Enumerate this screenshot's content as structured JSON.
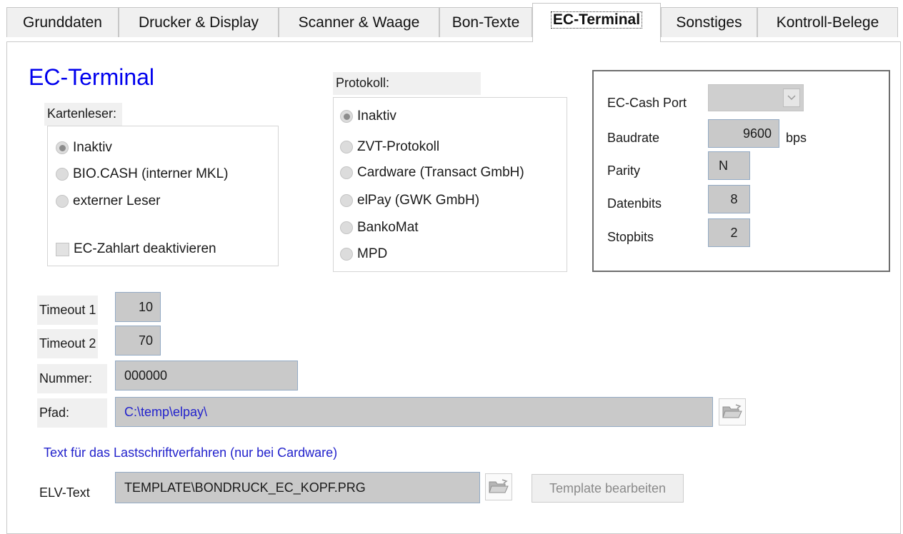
{
  "tabs": [
    "Grunddaten",
    "Drucker & Display",
    "Scanner & Waage",
    "Bon-Texte",
    "EC-Terminal",
    "Sonstiges",
    "Kontroll-Belege"
  ],
  "active_tab": "EC-Terminal",
  "page_title": "EC-Terminal",
  "kartenleser": {
    "label": "Kartenleser:",
    "options": [
      "Inaktiv",
      "BIO.CASH (interner MKL)",
      "externer Leser"
    ],
    "selected": "Inaktiv",
    "checkbox_label": "EC-Zahlart deaktivieren",
    "checkbox_checked": false
  },
  "protokoll": {
    "label": "Protokoll:",
    "options": [
      "Inaktiv",
      "ZVT-Protokoll",
      "Cardware (Transact GmbH)",
      "elPay (GWK GmbH)",
      "BankoMat",
      "MPD"
    ],
    "selected": "Inaktiv"
  },
  "ec_cash": {
    "port_label": "EC-Cash Port",
    "port_value": "",
    "baudrate_label": "Baudrate",
    "baudrate_value": "9600",
    "baudrate_unit": "bps",
    "parity_label": "Parity",
    "parity_value": "N",
    "datenbits_label": "Datenbits",
    "datenbits_value": "8",
    "stopbits_label": "Stopbits",
    "stopbits_value": "2"
  },
  "timeout1": {
    "label": "Timeout 1",
    "value": "10"
  },
  "timeout2": {
    "label": "Timeout 2",
    "value": "70"
  },
  "nummer": {
    "label": "Nummer:",
    "value": "000000"
  },
  "pfad": {
    "label": "Pfad:",
    "value": "C:\\temp\\elpay\\"
  },
  "lastschrift_hint": "Text für das Lastschriftverfahren (nur bei Cardware)",
  "elv": {
    "label": "ELV-Text",
    "value": "TEMPLATE\\BONDRUCK_EC_KOPF.PRG",
    "edit_button": "Template bearbeiten"
  },
  "colors": {
    "title_blue": "#0000ee",
    "path_text": "#2222cc",
    "field_bg": "#c9c9c9"
  }
}
